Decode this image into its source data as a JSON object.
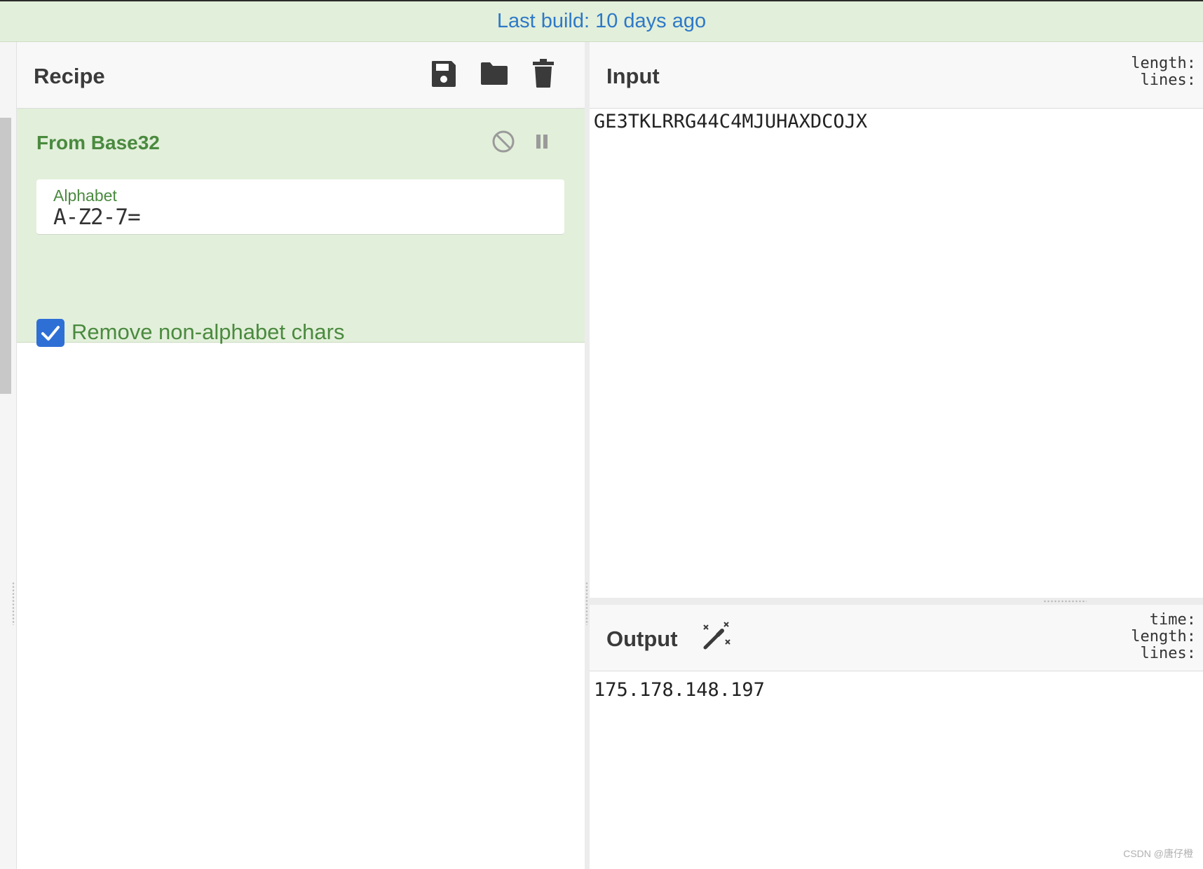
{
  "banner": {
    "text": "Last build: 10 days ago"
  },
  "recipe": {
    "title": "Recipe",
    "icons": [
      "save-icon",
      "folder-icon",
      "trash-icon"
    ],
    "operation": {
      "title": "From Base32",
      "icons": [
        "disable-icon",
        "pause-icon"
      ],
      "alphabet_label": "Alphabet",
      "alphabet_value": "A-Z2-7=",
      "checkbox_label": "Remove non-alphabet chars",
      "checkbox_checked": true
    }
  },
  "input": {
    "title": "Input",
    "stats": [
      "length:",
      "lines:"
    ],
    "text": "GE3TKLRRG44C4MJUHAXDCOJX"
  },
  "output": {
    "title": "Output",
    "icon": "magic-wand-icon",
    "stats": [
      "time:",
      "length:",
      "lines:"
    ],
    "text": "175.178.148.197"
  },
  "watermark": "CSDN @唐仔橙",
  "colors": {
    "banner_bg": "#e2efda",
    "banner_text": "#2e79c7",
    "op_bg": "#e2efda",
    "op_text": "#4a8a3f",
    "checkbox": "#2e6fd6"
  }
}
